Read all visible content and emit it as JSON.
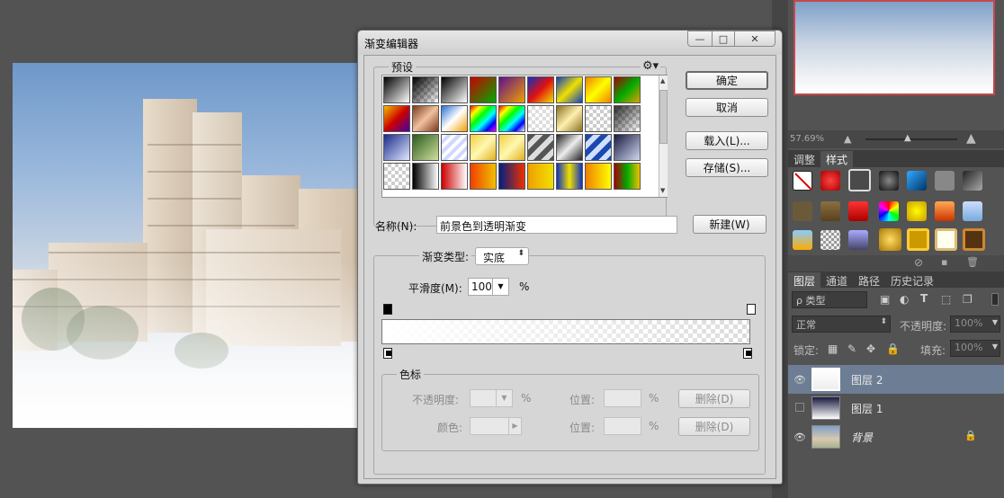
{
  "dialog": {
    "title": "渐变编辑器",
    "presets_label": "预设",
    "presets_gear_icon": "gear-icon",
    "buttons": {
      "ok": "确定",
      "cancel": "取消",
      "load": "载入(L)...",
      "save": "存储(S)...",
      "new": "新建(W)"
    },
    "name_label": "名称(N):",
    "name_value": "前景色到透明渐变",
    "gradient_type_label": "渐变类型:",
    "gradient_type_value": "实底",
    "smoothness_label": "平滑度(M):",
    "smoothness_value": "100",
    "smoothness_unit": "%",
    "color_stops": {
      "group_label": "色标",
      "opacity_label": "不透明度:",
      "opacity_unit": "%",
      "location_label": "位置:",
      "location_unit": "%",
      "delete_label": "删除(D)",
      "color_label": "颜色:"
    }
  },
  "window_controls": {
    "minimize": "—",
    "maximize": "□",
    "close": "✕"
  },
  "navigator": {
    "zoom": "57.69%"
  },
  "styles_panel": {
    "tabs": [
      "调整",
      "样式"
    ],
    "active_tab": "样式"
  },
  "layers_panel": {
    "tabs": [
      "图层",
      "通道",
      "路径",
      "历史记录"
    ],
    "active_tab": "图层",
    "filter_label": "ρ 类型",
    "blend_mode": "正常",
    "opacity_label": "不透明度:",
    "opacity_value": "100%",
    "lock_label": "锁定:",
    "fill_label": "填充:",
    "fill_value": "100%",
    "layers": [
      {
        "name": "图层 2",
        "visible": true,
        "selected": true
      },
      {
        "name": "图层 1",
        "visible": false,
        "selected": false
      },
      {
        "name": "背景",
        "visible": true,
        "selected": false,
        "locked": true
      }
    ]
  },
  "colors": {
    "panel_bg": "#535353",
    "dialog_bg": "#d6d6d6",
    "selected_layer": "#6d7d94",
    "nav_frame": "#c8474a"
  }
}
